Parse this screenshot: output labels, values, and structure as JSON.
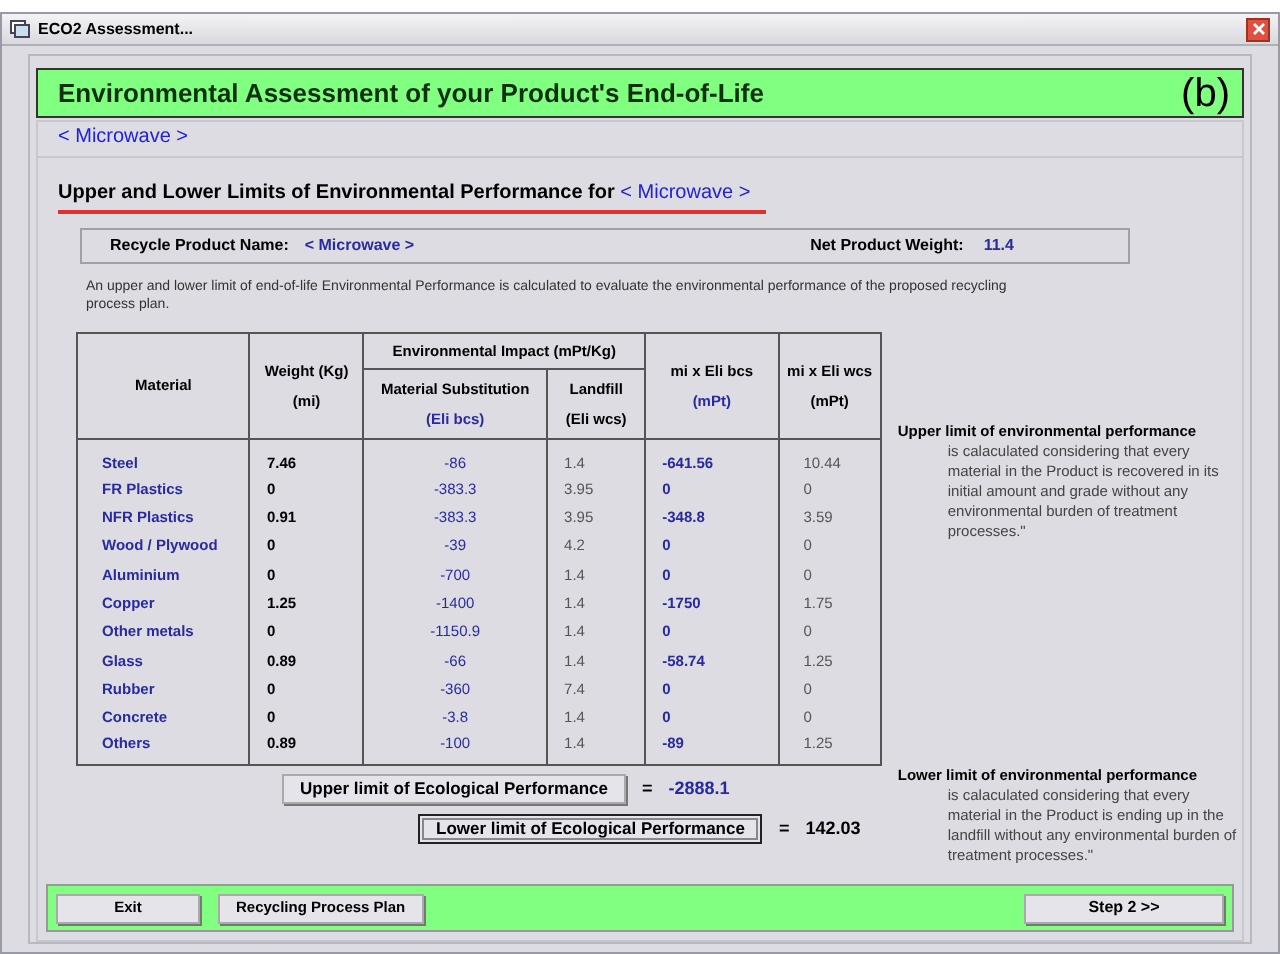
{
  "window": {
    "title": "ECO2 Assessment..."
  },
  "header": {
    "title": "Environmental Assessment of your Product's End-of-Life",
    "label": "(b)"
  },
  "product_link": "< Microwave >",
  "section_heading": {
    "text": "Upper and Lower Limits of Environmental Performance for",
    "product": "< Microwave >"
  },
  "product_info": {
    "name_label": "Recycle Product Name:",
    "name_value": "< Microwave >",
    "weight_label": "Net Product Weight:",
    "weight_value": "11.4"
  },
  "description": "An upper and lower limit of end-of-life Environmental Performance is calculated to evaluate the environmental performance of the proposed recycling process plan.",
  "table": {
    "group_header": "Environmental Impact (mPt/Kg)",
    "columns": [
      {
        "label": "Material",
        "kind": "name",
        "grouped": false
      },
      {
        "label": "Weight (Kg)",
        "unit": "(mi)",
        "kind": "weight",
        "grouped": false
      },
      {
        "label": "Material Substitution",
        "unit": "(Eli bcs)",
        "kind": "bcs",
        "grouped": true
      },
      {
        "label": "Landfill",
        "unit": "(Eli wcs)",
        "kind": "wcs",
        "grouped": true
      },
      {
        "label": "mi x Eli bcs",
        "unit": "(mPt)",
        "kind": "bcs_total",
        "grouped": false
      },
      {
        "label": "mi x Eli wcs",
        "unit": "(mPt)",
        "kind": "wcs_total",
        "grouped": false
      }
    ],
    "rows": [
      [
        "Steel",
        "7.46",
        "-86",
        "1.4",
        "-641.56",
        "10.44"
      ],
      [
        "FR Plastics",
        "0",
        "-383.3",
        "3.95",
        "0",
        "0"
      ],
      [
        "NFR Plastics",
        "0.91",
        "-383.3",
        "3.95",
        "-348.8",
        "3.59"
      ],
      [
        "Wood / Plywood",
        "0",
        "-39",
        "4.2",
        "0",
        "0"
      ],
      [
        "Aluminium",
        "0",
        "-700",
        "1.4",
        "0",
        "0"
      ],
      [
        "Copper",
        "1.25",
        "-1400",
        "1.4",
        "-1750",
        "1.75"
      ],
      [
        "Other metals",
        "0",
        "-1150.9",
        "1.4",
        "0",
        "0"
      ],
      [
        "Glass",
        "0.89",
        "-66",
        "1.4",
        "-58.74",
        "1.25"
      ],
      [
        "Rubber",
        "0",
        "-360",
        "7.4",
        "0",
        "0"
      ],
      [
        "Concrete",
        "0",
        "-3.8",
        "1.4",
        "0",
        "0"
      ],
      [
        "Others",
        "0.89",
        "-100",
        "1.4",
        "-89",
        "1.25"
      ]
    ]
  },
  "results": [
    {
      "kind": "upper",
      "button": "Upper limit of Ecological Performance",
      "equals": "=",
      "value": "-2888.1",
      "focused": false
    },
    {
      "kind": "lower",
      "button": "Lower limit of Ecological Performance",
      "equals": "=",
      "value": "142.03",
      "focused": true
    }
  ],
  "notes": [
    {
      "title": "Upper limit of environmental performance",
      "body": "is calaculated considering that every material in the Product is recovered in its initial amount and grade without any environmental burden of treatment processes.\""
    },
    {
      "title": "Lower limit of environmental performance",
      "body": "is calaculated considering that every material in the Product is ending up in the landfill without any environmental burden of treatment processes.\""
    }
  ],
  "footer_buttons": [
    "Exit",
    "Recycling Process Plan"
  ],
  "next_button": "Step 2 >>"
}
